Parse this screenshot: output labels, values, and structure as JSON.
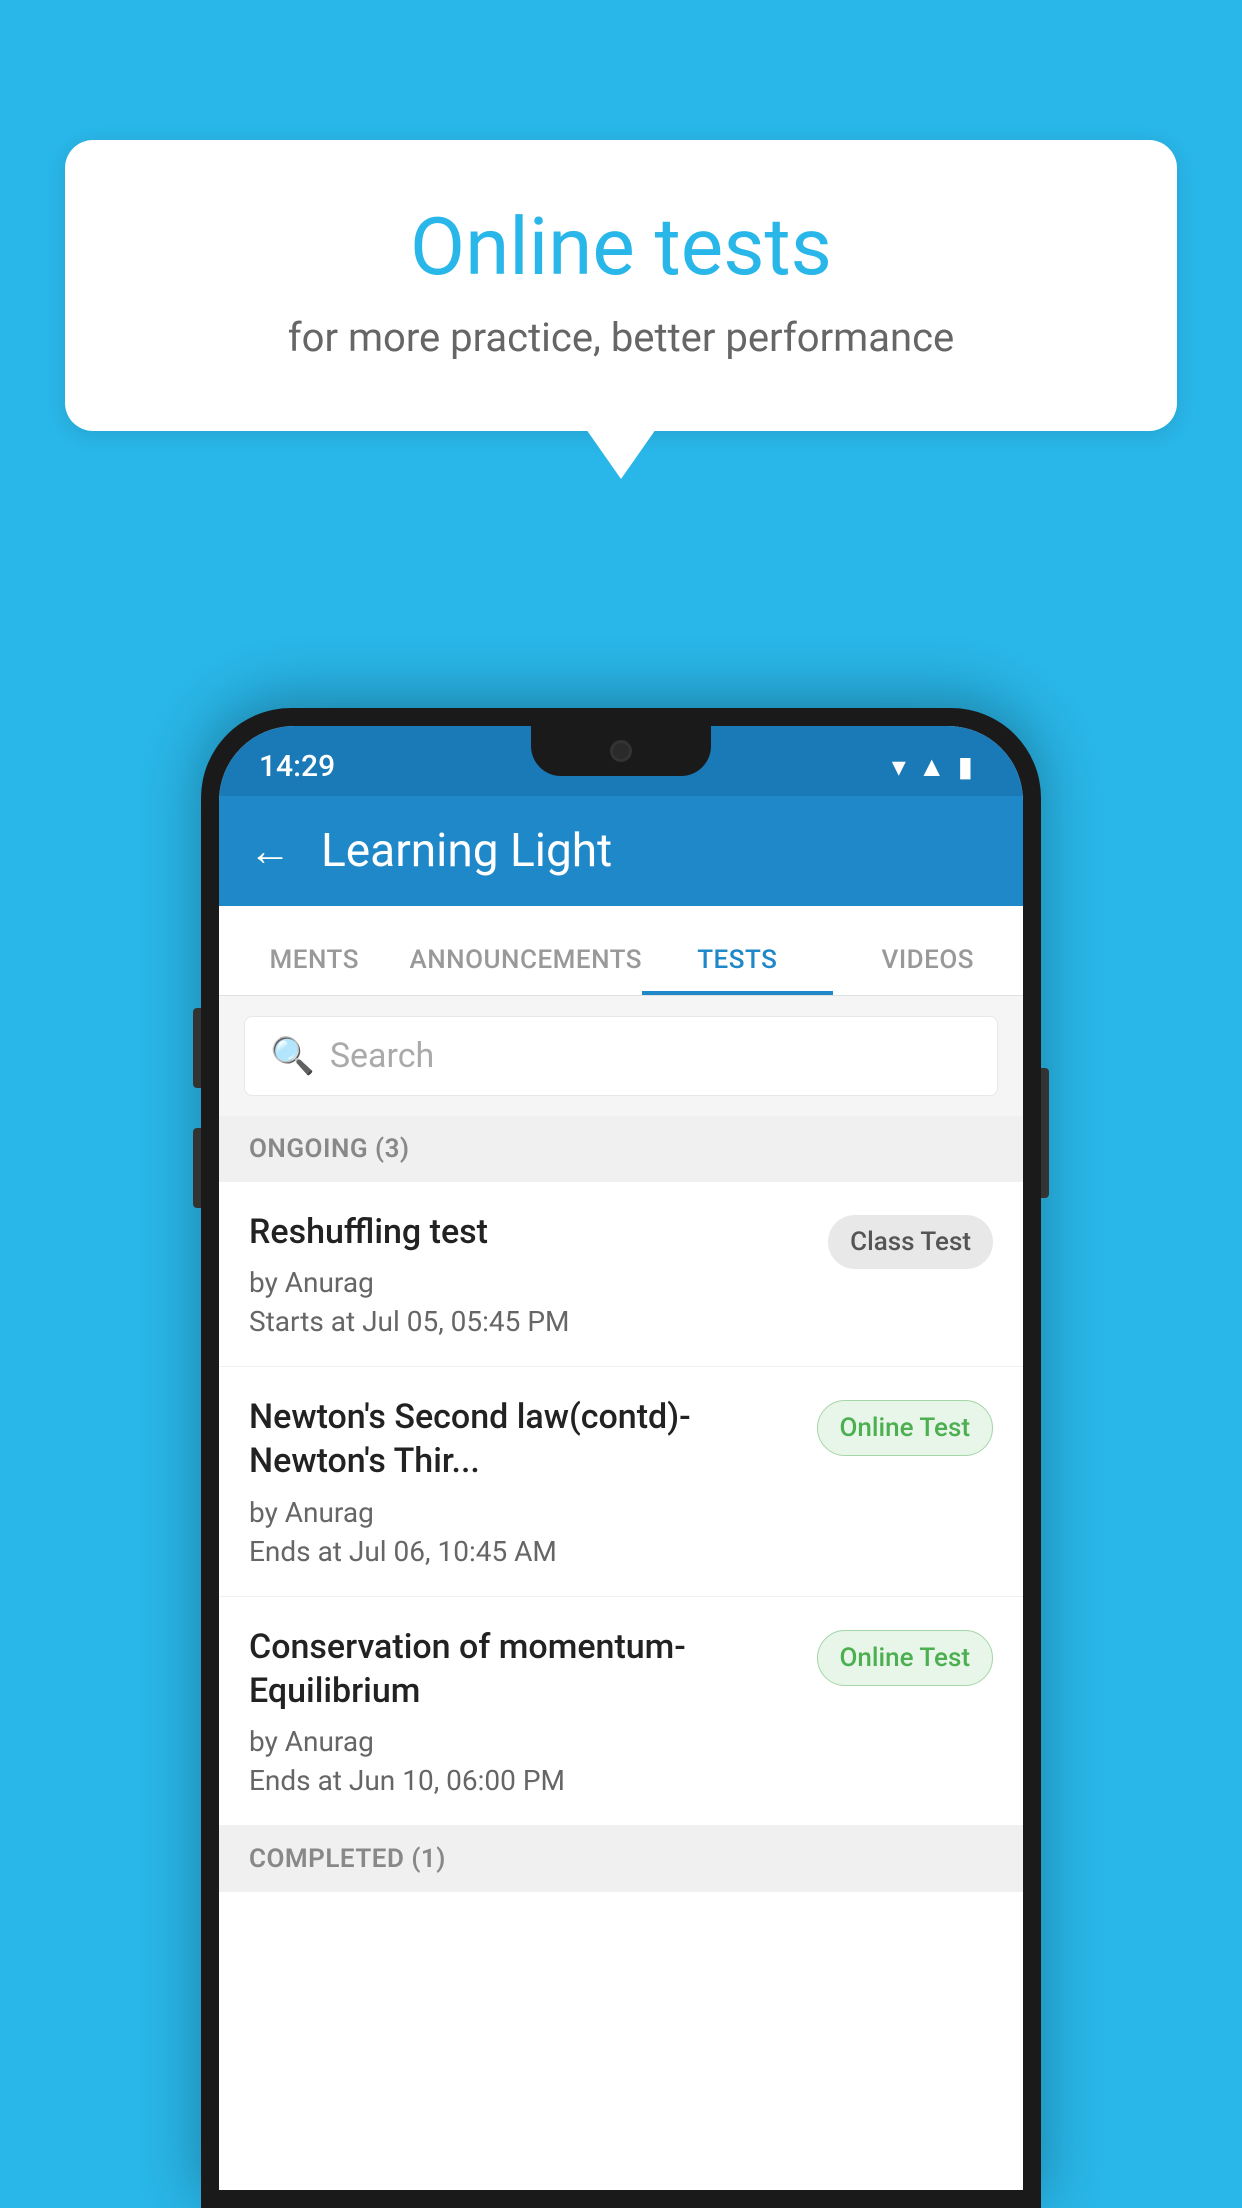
{
  "background_color": "#29b6e8",
  "bubble": {
    "title": "Online tests",
    "subtitle": "for more practice, better performance"
  },
  "status_bar": {
    "time": "14:29",
    "icons": [
      "wifi",
      "signal",
      "battery"
    ]
  },
  "app_bar": {
    "title": "Learning Light",
    "back_label": "←"
  },
  "tabs": [
    {
      "label": "MENTS",
      "active": false
    },
    {
      "label": "ANNOUNCEMENTS",
      "active": false
    },
    {
      "label": "TESTS",
      "active": true
    },
    {
      "label": "VIDEOS",
      "active": false
    }
  ],
  "search": {
    "placeholder": "Search"
  },
  "ongoing_section": {
    "label": "ONGOING (3)"
  },
  "tests": [
    {
      "name": "Reshuffling test",
      "author": "by Anurag",
      "time_label": "Starts at",
      "time": "Jul 05, 05:45 PM",
      "badge": "Class Test",
      "badge_type": "class"
    },
    {
      "name": "Newton's Second law(contd)-Newton's Thir...",
      "author": "by Anurag",
      "time_label": "Ends at",
      "time": "Jul 06, 10:45 AM",
      "badge": "Online Test",
      "badge_type": "online"
    },
    {
      "name": "Conservation of momentum-Equilibrium",
      "author": "by Anurag",
      "time_label": "Ends at",
      "time": "Jun 10, 06:00 PM",
      "badge": "Online Test",
      "badge_type": "online"
    }
  ],
  "completed_section": {
    "label": "COMPLETED (1)"
  }
}
